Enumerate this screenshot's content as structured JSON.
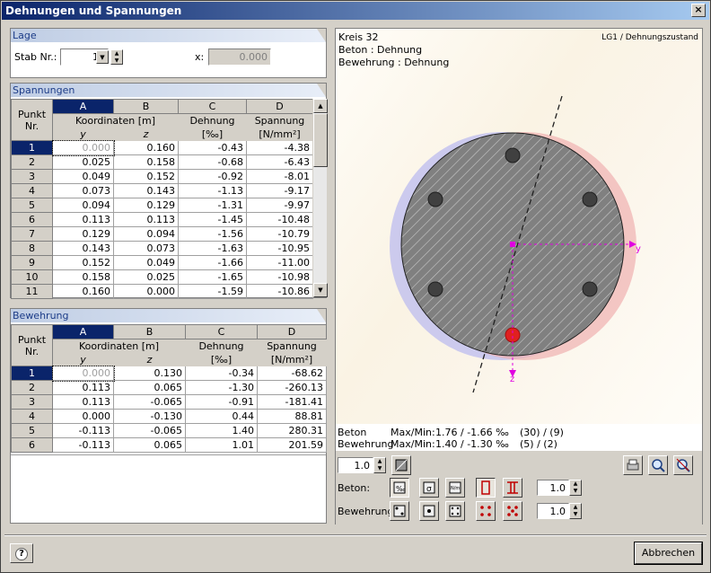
{
  "window": {
    "title": "Dehnungen und Spannungen",
    "close": "×"
  },
  "lage": {
    "header": "Lage",
    "stab_label": "Stab Nr.:",
    "stab_value": "19",
    "x_label": "x:",
    "x_value": "0.000"
  },
  "spannungen": {
    "header": "Spannungen",
    "cols": [
      "A",
      "B",
      "C",
      "D"
    ],
    "punkt": [
      "Punkt",
      "Nr."
    ],
    "h_koord": "Koordinaten [m]",
    "h_dehnung": "Dehnung",
    "h_spannung": "Spannung",
    "sub_y": "y",
    "sub_z": "z",
    "u_dehnung": "[‰]",
    "u_spannung": "[N/mm²]",
    "rows": [
      [
        "1",
        "0.000",
        "0.160",
        "-0.43",
        "-4.38"
      ],
      [
        "2",
        "0.025",
        "0.158",
        "-0.68",
        "-6.43"
      ],
      [
        "3",
        "0.049",
        "0.152",
        "-0.92",
        "-8.01"
      ],
      [
        "4",
        "0.073",
        "0.143",
        "-1.13",
        "-9.17"
      ],
      [
        "5",
        "0.094",
        "0.129",
        "-1.31",
        "-9.97"
      ],
      [
        "6",
        "0.113",
        "0.113",
        "-1.45",
        "-10.48"
      ],
      [
        "7",
        "0.129",
        "0.094",
        "-1.56",
        "-10.79"
      ],
      [
        "8",
        "0.143",
        "0.073",
        "-1.63",
        "-10.95"
      ],
      [
        "9",
        "0.152",
        "0.049",
        "-1.66",
        "-11.00"
      ],
      [
        "10",
        "0.158",
        "0.025",
        "-1.65",
        "-10.98"
      ],
      [
        "11",
        "0.160",
        "0.000",
        "-1.59",
        "-10.86"
      ]
    ]
  },
  "bewehrung": {
    "header": "Bewehrung",
    "cols": [
      "A",
      "B",
      "C",
      "D"
    ],
    "punkt": [
      "Punkt",
      "Nr."
    ],
    "h_koord": "Koordinaten [m]",
    "h_dehnung": "Dehnung",
    "h_spannung": "Spannung",
    "sub_y": "y",
    "sub_z": "z",
    "u_dehnung": "[‰]",
    "u_spannung": "[N/mm²]",
    "rows": [
      [
        "1",
        "0.000",
        "0.130",
        "-0.34",
        "-68.62"
      ],
      [
        "2",
        "0.113",
        "0.065",
        "-1.30",
        "-260.13"
      ],
      [
        "3",
        "0.113",
        "-0.065",
        "-0.91",
        "-181.41"
      ],
      [
        "4",
        "0.000",
        "-0.130",
        "0.44",
        "88.81"
      ],
      [
        "5",
        "-0.113",
        "-0.065",
        "1.40",
        "280.31"
      ],
      [
        "6",
        "-0.113",
        "0.065",
        "1.01",
        "201.59"
      ]
    ]
  },
  "graphic": {
    "line1": "Kreis 32",
    "line2": "Beton : Dehnung",
    "line3": "Bewehrung : Dehnung",
    "case": "LG1 / Dehnungszustand",
    "axis_y": "y",
    "axis_z": "z",
    "info_beton_label": "Beton",
    "info_beton_mm": "Max/Min:",
    "info_beton_val": "1.76 / -1.66 ‰",
    "info_beton_pts": "(30) / (9)",
    "info_bew_label": "Bewehrung",
    "info_bew_mm": "Max/Min:",
    "info_bew_val": "1.40 / -1.30 ‰",
    "info_bew_pts": "(5) / (2)",
    "scale_value": "1.0",
    "beton_label": "Beton:",
    "bew_label": "Bewehrung:",
    "beton_scale": "1.0",
    "bew_scale": "1.0",
    "colors": {
      "compression": "#8c8cf0",
      "tension": "#f08c8c",
      "marker": "#e000e0",
      "selected": "#e02020"
    }
  },
  "footer": {
    "help": "?",
    "cancel": "Abbrechen"
  }
}
